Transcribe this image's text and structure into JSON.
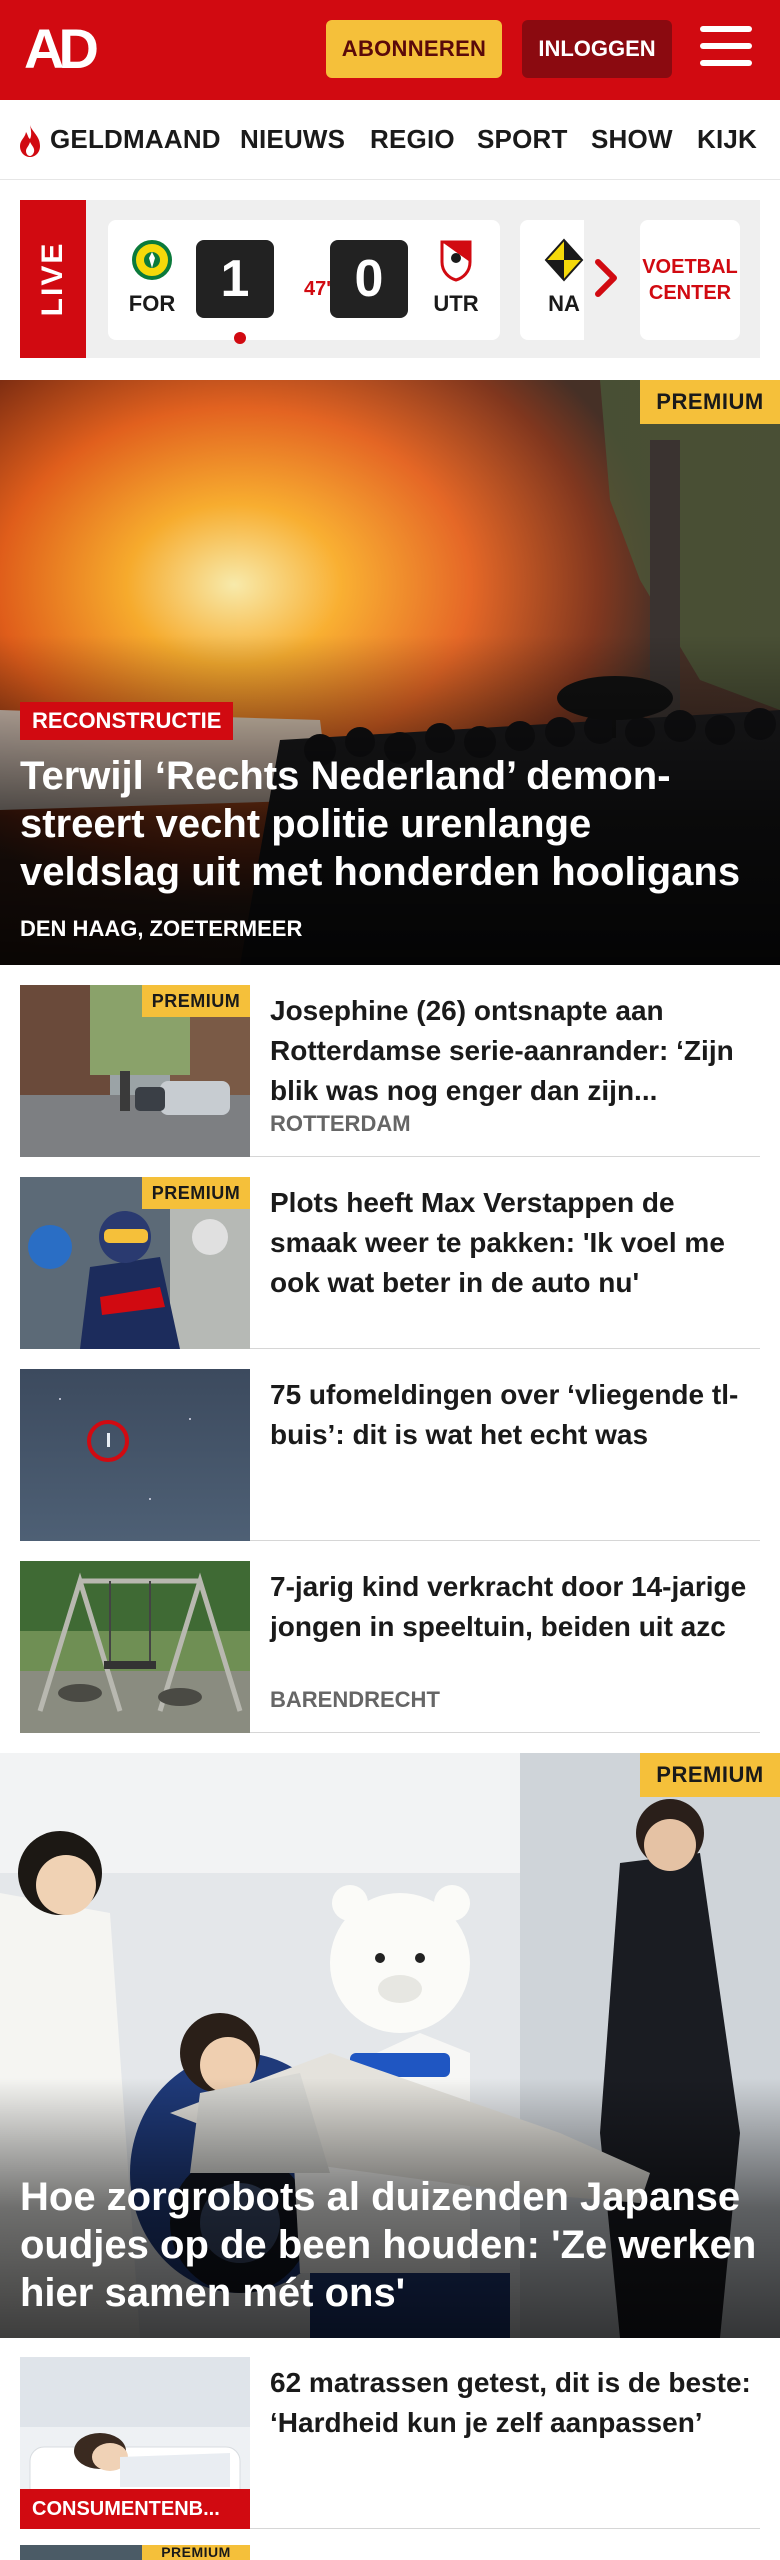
{
  "header": {
    "logo_text": "AD",
    "subscribe_label": "ABONNEREN",
    "login_label": "INLOGGEN",
    "brand_color": "#d10a11"
  },
  "nav": {
    "items": [
      {
        "label": "GELDMAAND",
        "icon": "flame-icon"
      },
      {
        "label": "NIEUWS"
      },
      {
        "label": "REGIO"
      },
      {
        "label": "SPORT"
      },
      {
        "label": "SHOW"
      },
      {
        "label": "KIJK"
      }
    ]
  },
  "live": {
    "tag": "LIVE",
    "match": {
      "home": "FOR",
      "away": "UTR",
      "home_score": "1",
      "away_score": "0",
      "minute": "47'"
    },
    "next_match_home": "NA",
    "voetbal_center_line1": "VOETBAL",
    "voetbal_center_line2": "CENTER"
  },
  "hero": {
    "premium": "PREMIUM",
    "label": "RECONSTRUCTIE",
    "title": "Terwijl ‘Rechts Nederland’ demon­streert vecht politie urenlange veldslag uit met honderden hooligans",
    "location": "DEN HAAG, ZOETERMEER"
  },
  "articles": [
    {
      "premium": "PREMIUM",
      "title": "Josephine (26) ontsnapte aan Rotterdamse serie-aanrander: ‘Zijn blik was nog enger dan zijn...",
      "location": "ROTTERDAM"
    },
    {
      "premium": "PREMIUM",
      "title": "Plots heeft Max Verstappen de smaak weer te pakken: 'Ik voel me ook wat beter in de auto nu'",
      "location": ""
    },
    {
      "premium": "",
      "title": "75 ufomeldingen over ‘vliegende tl-buis’: dit is wat het echt was",
      "location": ""
    },
    {
      "premium": "",
      "title": "7-jarig kind verkracht door 14-jarige jongen in speeltuin, beiden uit azc",
      "location": "BARENDRECHT"
    }
  ],
  "hero2": {
    "premium": "PREMIUM",
    "title": "Hoe zorgrobots al duizenden Japanse oudjes op de been houden: 'Ze werken hier samen mét ons'"
  },
  "article_bottom": {
    "title": "62 matrassen getest, dit is de beste: ‘Hardheid kun je zelf aanpassen’",
    "category": "CONSUMENTENB..."
  },
  "article_peek": {
    "premium": "PREMIUM"
  }
}
